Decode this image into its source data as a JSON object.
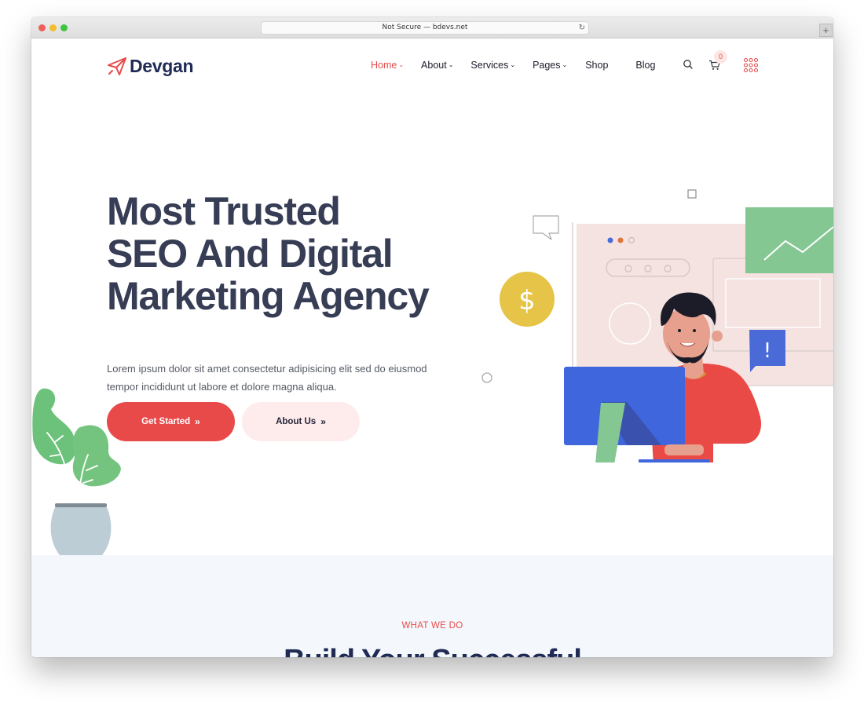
{
  "browser": {
    "url_text": "Not Secure — bdevs.net",
    "reload_glyph": "↻",
    "new_tab_glyph": "+"
  },
  "header": {
    "logo_text": "Devgan",
    "logo_icon": "paper-plane-icon",
    "nav": {
      "home": "Home",
      "about": "About",
      "services": "Services",
      "pages": "Pages",
      "shop": "Shop",
      "blog": "Blog"
    },
    "dropdown_glyph": "⌄",
    "cart_count": "0",
    "icons": [
      "search-icon",
      "cart-icon",
      "grid-menu-icon"
    ]
  },
  "hero": {
    "title_lines": [
      "Most Trusted",
      "SEO And Digital",
      "Marketing Agency"
    ],
    "text_lines": [
      "Lorem ipsum dolor sit amet consectetur adipisicing elit sed do eiusmod",
      "tempor incididunt ut labore et dolore magna aliqua."
    ],
    "primary_button": "Get Started",
    "secondary_button": "About Us",
    "button_arrow_glyph": "»",
    "illustration_dollar": "$",
    "illustration_alert": "!"
  },
  "section_services": {
    "eyebrow": "WHAT WE DO",
    "title": "Build Your Successful"
  },
  "colors": {
    "accent": "#e84a4a",
    "heading": "#363d54",
    "brand_navy": "#1f2a55",
    "button_secondary_bg": "#fdeceb",
    "section_bg": "#f4f8fc"
  }
}
